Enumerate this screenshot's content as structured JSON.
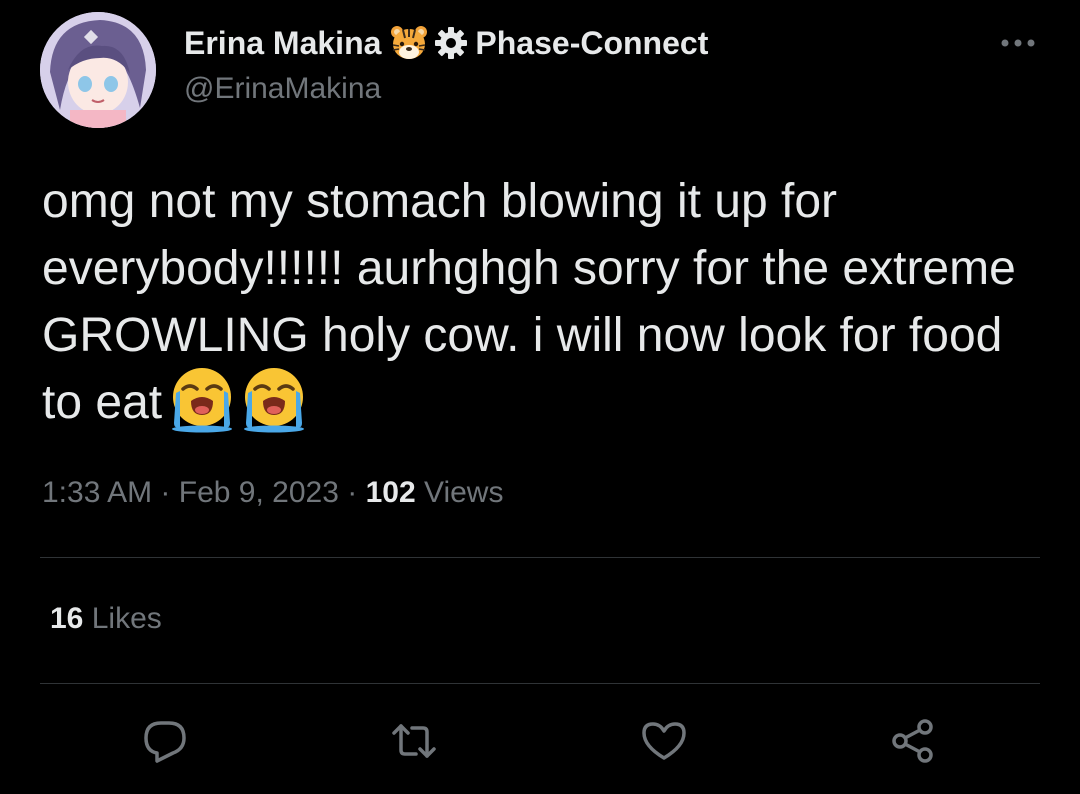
{
  "author": {
    "display_name": "Erina Makina",
    "badge_emoji_icon": "tiger-face-icon",
    "affiliation_icon": "gear-icon",
    "affiliation": "Phase-Connect",
    "handle": "@ErinaMakina"
  },
  "tweet": {
    "text": "omg not my stomach blowing it up for everybody!!!!!! aurhghgh sorry for the extreme GROWLING holy cow. i will now look for food to eat",
    "trailing_emojis": [
      "loudly-crying-face-icon",
      "loudly-crying-face-icon"
    ]
  },
  "meta": {
    "time": "1:33 AM",
    "separator": "·",
    "date": "Feb 9, 2023",
    "views_count": "102",
    "views_label": "Views"
  },
  "likes": {
    "count": "16",
    "label": "Likes"
  },
  "actions": [
    "reply-icon",
    "retweet-icon",
    "like-icon",
    "share-icon"
  ],
  "colors": {
    "background": "#000000",
    "primary_text": "#e7e9ea",
    "secondary_text": "#71767b",
    "divider": "#2f3336"
  }
}
